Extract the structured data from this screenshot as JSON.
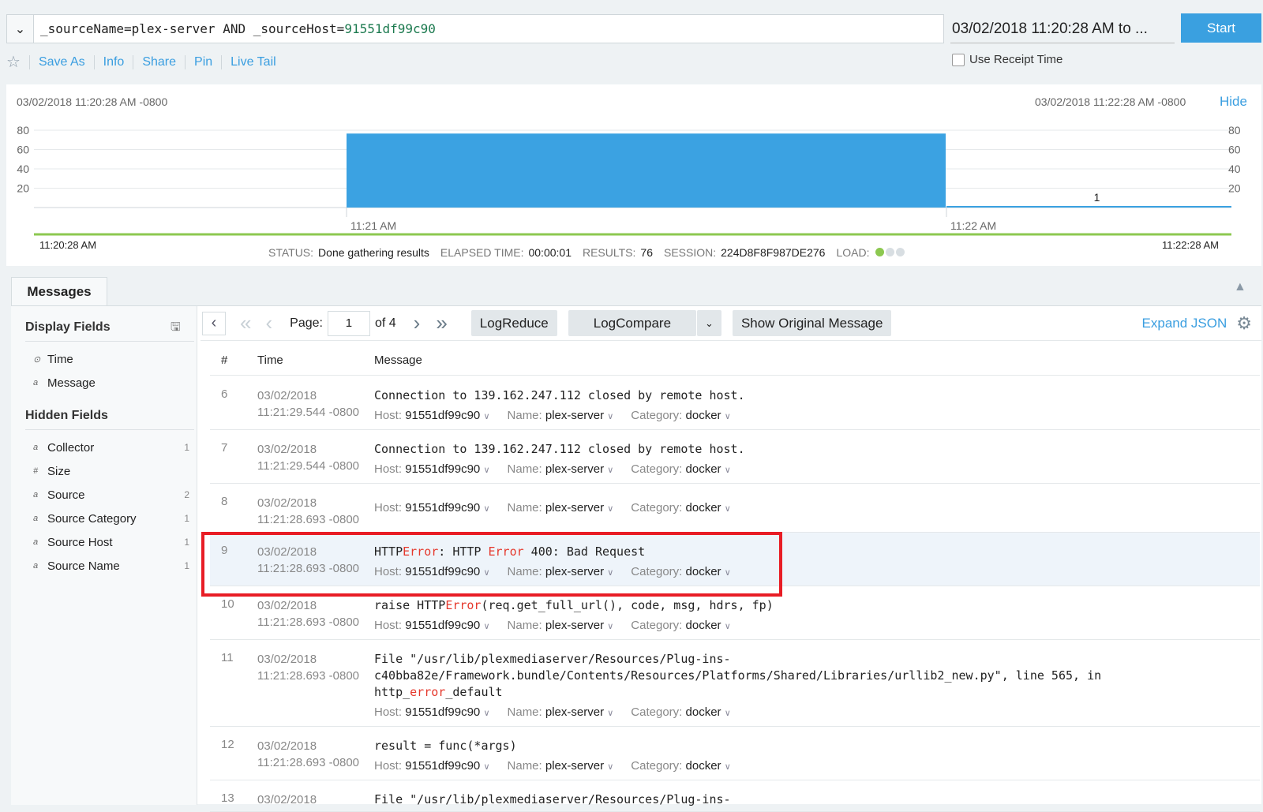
{
  "query": {
    "text_prefix": "_sourceName=plex-server AND _sourceHost=",
    "host_value": "91551df99c90"
  },
  "time_range": "03/02/2018 11:20:28 AM to ...",
  "start_label": "Start",
  "toolbar": {
    "save_as": "Save As",
    "info": "Info",
    "share": "Share",
    "pin": "Pin",
    "live_tail": "Live Tail"
  },
  "use_receipt_time": "Use Receipt Time",
  "chart_data": {
    "type": "bar",
    "categories": [
      "11:21 AM",
      "11:22 AM"
    ],
    "values": [
      75,
      1
    ],
    "ylim": [
      0,
      80
    ],
    "yticks": [
      "80",
      "60",
      "40",
      "20"
    ],
    "start_label": "03/02/2018 11:20:28 AM -0800",
    "end_label": "03/02/2018 11:22:28 AM -0800",
    "hide_label": "Hide",
    "data_labels": [
      "",
      "1"
    ],
    "color": "#3ba2e2"
  },
  "timeline": {
    "start": "11:20:28 AM",
    "end": "11:22:28 AM"
  },
  "status": {
    "status_label": "STATUS:",
    "status": "Done gathering results",
    "elapsed_label": "ELAPSED TIME:",
    "elapsed": "00:00:01",
    "results_label": "RESULTS:",
    "results": "76",
    "session_label": "SESSION:",
    "session": "224D8F8F987DE276",
    "load_label": "LOAD:"
  },
  "messages_tab": "Messages",
  "sidebar": {
    "display_title": "Display Fields",
    "display": [
      {
        "type": "⊙",
        "name": "Time"
      },
      {
        "type": "a",
        "name": "Message"
      }
    ],
    "hidden_title": "Hidden Fields",
    "hidden": [
      {
        "type": "a",
        "name": "Collector",
        "count": "1"
      },
      {
        "type": "#",
        "name": "Size",
        "count": ""
      },
      {
        "type": "a",
        "name": "Source",
        "count": "2"
      },
      {
        "type": "a",
        "name": "Source Category",
        "count": "1"
      },
      {
        "type": "a",
        "name": "Source Host",
        "count": "1"
      },
      {
        "type": "a",
        "name": "Source Name",
        "count": "1"
      }
    ]
  },
  "pager": {
    "page_label": "Page:",
    "page": "1",
    "of": "of 4",
    "logreduce": "LogReduce",
    "logcompare": "LogCompare",
    "show_original": "Show Original Message",
    "expand_json": "Expand JSON"
  },
  "columns": {
    "num": "#",
    "time": "Time",
    "message": "Message"
  },
  "meta_labels": {
    "host": "Host:",
    "name": "Name:",
    "category": "Category:"
  },
  "rows": [
    {
      "n": "6",
      "date": "03/02/2018",
      "time": "11:21:29.544 -0800",
      "msg": [
        "Connection to 139.162.247.112 closed by remote host."
      ],
      "host": "91551df99c90",
      "name": "plex-server",
      "category": "docker"
    },
    {
      "n": "7",
      "date": "03/02/2018",
      "time": "11:21:29.544 -0800",
      "msg": [
        "Connection to 139.162.247.112 closed by remote host."
      ],
      "host": "91551df99c90",
      "name": "plex-server",
      "category": "docker"
    },
    {
      "n": "8",
      "date": "03/02/2018",
      "time": "11:21:28.693 -0800",
      "msg": [],
      "host": "91551df99c90",
      "name": "plex-server",
      "category": "docker"
    },
    {
      "n": "9",
      "date": "03/02/2018",
      "time": "11:21:28.693 -0800",
      "msg": [
        "HTTP",
        "Error",
        ": HTTP ",
        "Error",
        " 400: Bad Request"
      ],
      "host": "91551df99c90",
      "name": "plex-server",
      "category": "docker"
    },
    {
      "n": "10",
      "date": "03/02/2018",
      "time": "11:21:28.693 -0800",
      "msg": [
        "raise HTTP",
        "Error",
        "(req.get_full_url(), code, msg, hdrs, fp)"
      ],
      "host": "91551df99c90",
      "name": "plex-server",
      "category": "docker"
    },
    {
      "n": "11",
      "date": "03/02/2018",
      "time": "11:21:28.693 -0800",
      "msg": [
        "File \"/usr/lib/plexmediaserver/Resources/Plug-ins-\nc40bba82e/Framework.bundle/Contents/Resources/Platforms/Shared/Libraries/urllib2_new.py\", line 565, in\nhttp_",
        "error",
        "_default"
      ],
      "host": "91551df99c90",
      "name": "plex-server",
      "category": "docker"
    },
    {
      "n": "12",
      "date": "03/02/2018",
      "time": "11:21:28.693 -0800",
      "msg": [
        "result = func(*args)"
      ],
      "host": "91551df99c90",
      "name": "plex-server",
      "category": "docker"
    },
    {
      "n": "13",
      "date": "03/02/2018",
      "time": "",
      "msg": [
        "File \"/usr/lib/plexmediaserver/Resources/Plug-ins-"
      ],
      "host": "",
      "name": "",
      "category": ""
    }
  ]
}
